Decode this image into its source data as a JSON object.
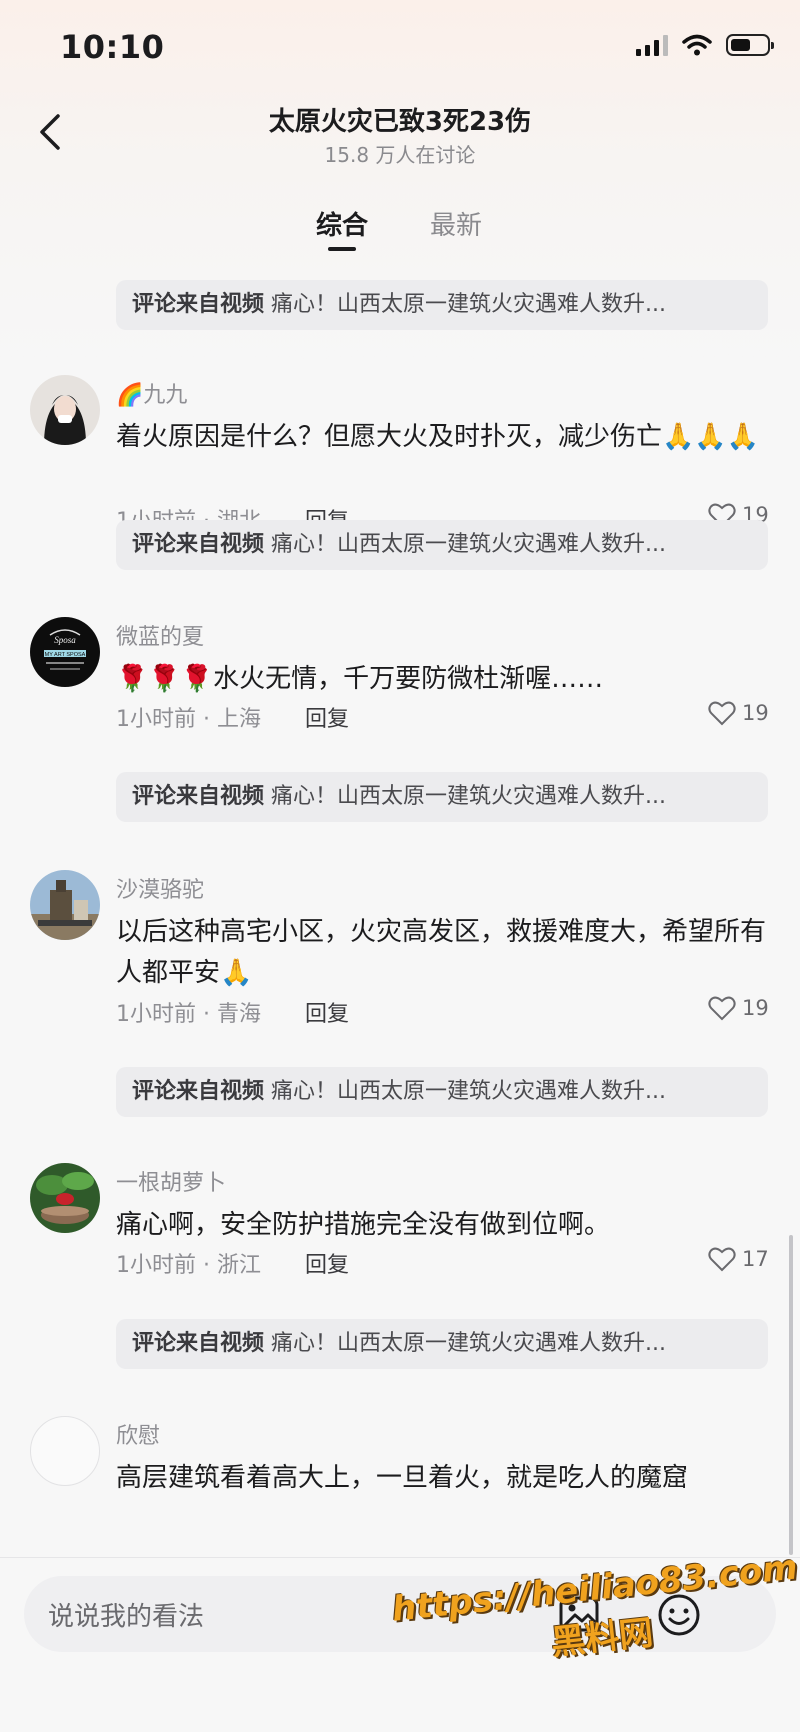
{
  "status_bar": {
    "time": "10:10",
    "battery_level": 0.55
  },
  "header": {
    "title": "太原火灾已致3死23伤",
    "subtitle": "15.8 万人在讨论"
  },
  "tabs": [
    {
      "label": "综合",
      "active": true
    },
    {
      "label": "最新",
      "active": false
    }
  ],
  "source_label": "评论来自视频",
  "source_title": "痛心！山西太原一建筑火灾遇难人数升...",
  "reply_label": "回复",
  "comments": [
    {
      "username": "九九",
      "username_emoji": "🌈",
      "text": "着火原因是什么？但愿大火及时扑灭，减少伤亡🙏🙏🙏",
      "meta": "1小时前 · 湖北",
      "likes": "19"
    },
    {
      "username": "微蓝的夏",
      "text": "🌹🌹🌹水火无情，千万要防微杜渐喔……",
      "meta": "1小时前 · 上海",
      "likes": "19",
      "avatar_text": "MY ART SPOSA"
    },
    {
      "username": "沙漠骆驼",
      "text": "以后这种高宅小区，火灾高发区，救援难度大，希望所有人都平安🙏",
      "meta": "1小时前 · 青海",
      "likes": "19"
    },
    {
      "username": "一根胡萝卜",
      "text": "痛心啊，安全防护措施完全没有做到位啊。",
      "meta": "1小时前 · 浙江",
      "likes": "17"
    },
    {
      "username": "欣慰",
      "text": "高层建筑看着高大上，一旦着火，就是吃人的魔窟"
    }
  ],
  "input": {
    "placeholder": "说说我的看法"
  },
  "watermark": {
    "url": "https://heiliao83.com",
    "name": "黑料网"
  },
  "colors": {
    "background": "#f7f7f7",
    "header_tint": "#fbf0ea",
    "watermark": "#f0a21e"
  }
}
